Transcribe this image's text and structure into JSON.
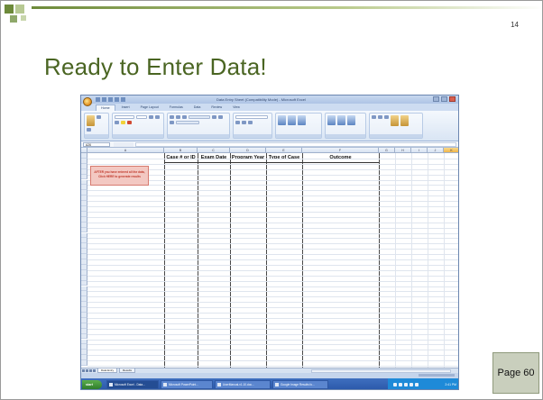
{
  "slide": {
    "number": "14",
    "title": "Ready to Enter Data!",
    "page_label": "Page 60",
    "accent_color": "#4a6522"
  },
  "excel": {
    "window_title": "Data Entry Sheet (Compatibility Mode) - Microsoft Excel",
    "ribbon_tabs": [
      "Home",
      "Insert",
      "Page Layout",
      "Formulas",
      "Data",
      "Review",
      "View"
    ],
    "active_tab": "Home",
    "name_box": "A26",
    "columns": [
      "A",
      "B",
      "C",
      "D",
      "E",
      "F",
      "G",
      "H",
      "I",
      "J",
      "K"
    ],
    "headers": [
      "Case # or ID",
      "Exam Date",
      "Program Year",
      "Type of Case",
      "Outcome"
    ],
    "note": {
      "line1": "AFTER you have entered all the data,",
      "line2": "Click HERE to generate results"
    },
    "sheet_tabs": [
      "Data Entry",
      "Results"
    ],
    "active_sheet": "Data Entry",
    "taskbar": {
      "start": "start",
      "items": [
        "Microsoft Excel - Data...",
        "Microsoft PowerPoint...",
        "UserManual-v1.10.doc...",
        "Google Image Results fo..."
      ],
      "active_item_index": 0,
      "clock": "2:41 PM"
    }
  }
}
